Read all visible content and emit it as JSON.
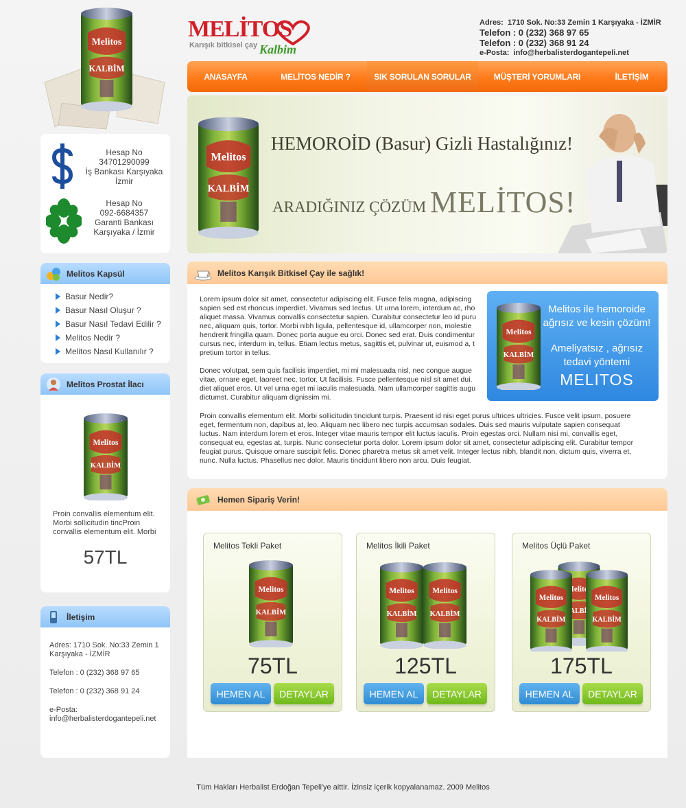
{
  "logo": {
    "brand": "MELİTOS",
    "tagline": "Karışık bitkisel çay",
    "script": "Kalbim"
  },
  "top_contact": {
    "address_label": "Adres:",
    "address": "1710 Sok. No:33 Zemin 1 Karşıyaka - İZMİR",
    "phone1": "Telefon : 0 (232) 368 97 65",
    "phone2": "Telefon : 0 (232) 368 91 24",
    "email_label": "e-Posta:",
    "email": "info@herbalisterdogantepeli.net"
  },
  "nav": {
    "items": [
      {
        "label": "ANASAYFA"
      },
      {
        "label": "MELİTOS NEDİR ?"
      },
      {
        "label": "SIK SORULAN SORULAR"
      },
      {
        "label": "MÜŞTERİ YORUMLARI"
      },
      {
        "label": "İLETİŞİM"
      }
    ]
  },
  "banner": {
    "headline": "HEMOROİD (Basur) Gizli Hastalığınız!",
    "sub_prefix": "ARADIĞINIZ ÇÖZÜM",
    "sub_brand": "MELİTOS!"
  },
  "bank": {
    "isbank": {
      "line1": "Hesap No",
      "line2": "34701290099",
      "line3": "İş Bankası Karşıyaka",
      "line4": "İzmir"
    },
    "garanti": {
      "line1": "Hesap No",
      "line2": "092-6684357",
      "line3": "Garanti Bankası",
      "line4": "Karşıyaka / İzmir"
    }
  },
  "kapsul": {
    "title": "Melitos Kapsül",
    "items": [
      {
        "label": "Basur Nedir?"
      },
      {
        "label": "Basur Nasıl Oluşur ?"
      },
      {
        "label": "Basur Nasıl Tedavi Edilir ?"
      },
      {
        "label": "Melitos Nedir ?"
      },
      {
        "label": "Melitos Nasıl Kullanılır ?"
      }
    ]
  },
  "prostat": {
    "title": "Melitos Prostat İlacı",
    "text": "Proin convallis elementum elit. Morbi sollicitudin tincProin convallis elementum elit. Morbi",
    "price": "57TL"
  },
  "iletisim": {
    "title": "İletişim",
    "address": "Adres:    1710 Sok. No:33 Zemin 1 Karşıyaka - İZMİR",
    "phone1": "Telefon : 0 (232) 368 97 65",
    "phone2": "Telefon : 0 (232) 368 91 24",
    "email_label": "e-Posta:",
    "email": "info@herbalisterdogantepeli.net"
  },
  "content": {
    "title": "Melitos Karışık Bitkisel Çay ile sağlık!",
    "p1_lines": [
      "Lorem ipsum dolor sit amet, consectetur adipiscing elit. Fusce felis magna, adipiscing",
      "sapien sed est rhoncus imperdiet. Vivamus sed lectus. Ut urna lorem, interdum ac, rho",
      "aliquet massa. Vivamus convallis consectetur sapien. Curabitur consectetur leo id puru",
      "nec, aliquam quis, tortor. Morbi nibh ligula, pellentesque id, ullamcorper non, molestie",
      "hendrerit fringilla quam. Donec porta augue eu orci. Donec sed erat. Duis condimentur",
      "cursus nec, interdum in, tellus. Etiam lectus metus, sagittis et, pulvinar ut, euismod a, t",
      "pretium tortor in tellus."
    ],
    "p2_lines": [
      "Donec volutpat, sem quis facilisis imperdiet, mi mi malesuada nisl, nec congue augue",
      "vitae, ornare eget, laoreet nec, tortor. Ut facilisis. Fusce pellentesque nisl sit amet dui.",
      "diet aliquet eros. Ut vel urna eget mi iaculis malesuada. Nam ullamcorper sagittis augu",
      "dictumst. Curabitur aliquam dignissim mi."
    ],
    "p3_lines": [
      "Proin convallis elementum elit. Morbi sollicitudin tincidunt turpis. Praesent id nisi eget purus ultrices ultricies. Fusce velit ipsum, posuere",
      "eget, fermentum non, dapibus at, leo. Aliquam nec libero nec turpis accumsan sodales. Duis sed mauris vulputate sapien consequat",
      "luctus. Nam interdum lorem et eros. Integer vitae mauris tempor elit luctus iaculis. Proin egestas orci. Nullam nisi mi, convallis eget,",
      "consequat eu, egestas at, turpis. Nunc consectetur porta dolor. Lorem ipsum dolor sit amet, consectetur adipiscing elit. Curabitur tempor",
      "feugiat purus. Quisque ornare suscipit felis. Donec pharetra metus sit amet velit. Integer lectus nibh, blandit non, dictum quis, viverra et,",
      "nunc. Nulla luctus. Phasellus nec dolor. Mauris tincidunt libero non arcu. Duis feugiat."
    ],
    "promo": {
      "line1": "Melitos ile hemoroide",
      "line2": "ağrısız ve kesin çözüm!",
      "line3": "Ameliyatsız , ağrısız",
      "line4": "tedavi yöntemi",
      "brand": "MELITOS"
    }
  },
  "order": {
    "title": "Hemen Sipariş Verin!",
    "buy_label": "HEMEN AL",
    "details_label": "DETAYLAR",
    "packages": [
      {
        "name": "Melitos Tekli Paket",
        "price": "75TL"
      },
      {
        "name": "Melitos İkili Paket",
        "price": "125TL"
      },
      {
        "name": "Melitos Üçlü Paket",
        "price": "175TL"
      }
    ]
  },
  "footer": {
    "text": "Tüm Hakları Herbalist Erdoğan Tepeli'ye aittir. İzinsiz içerik kopyalanamaz. 2009 Melitos"
  },
  "colors": {
    "nav_orange": "#ff7a1a",
    "side_head_blue": "#90c5f7",
    "content_head_peach": "#ffc896",
    "btn_blue": "#2f8cd3",
    "btn_green": "#6fb81c",
    "logo_red": "#d0202a"
  }
}
